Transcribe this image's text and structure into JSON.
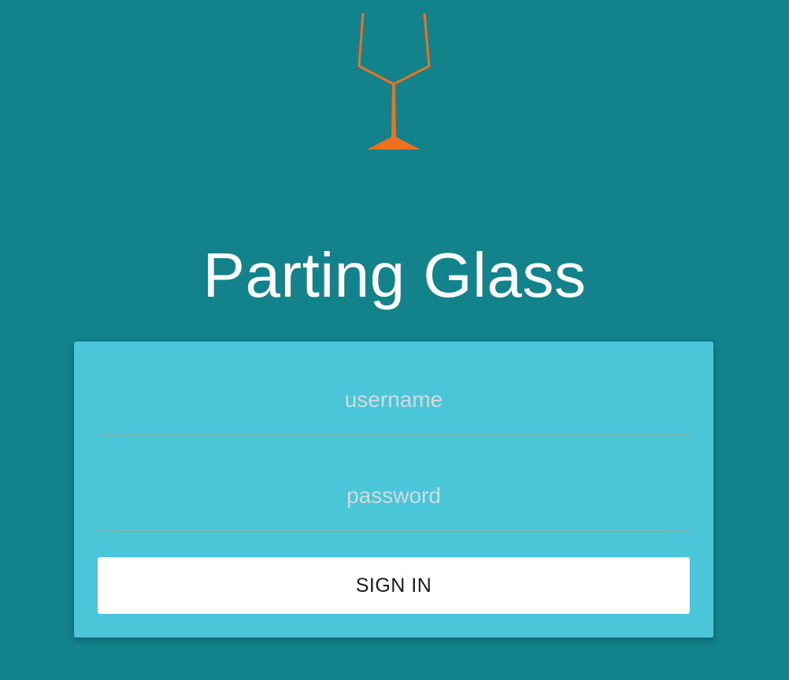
{
  "app": {
    "title": "Parting Glass",
    "logo_icon": "wine-glass-icon",
    "logo_color": "#f07020"
  },
  "colors": {
    "background": "#12828b",
    "card": "#4bc6d9",
    "button": "#ffffff",
    "title_text": "#ffffff"
  },
  "login": {
    "username_placeholder": "username",
    "username_value": "",
    "password_placeholder": "password",
    "password_value": "",
    "submit_label": "SIGN IN"
  }
}
